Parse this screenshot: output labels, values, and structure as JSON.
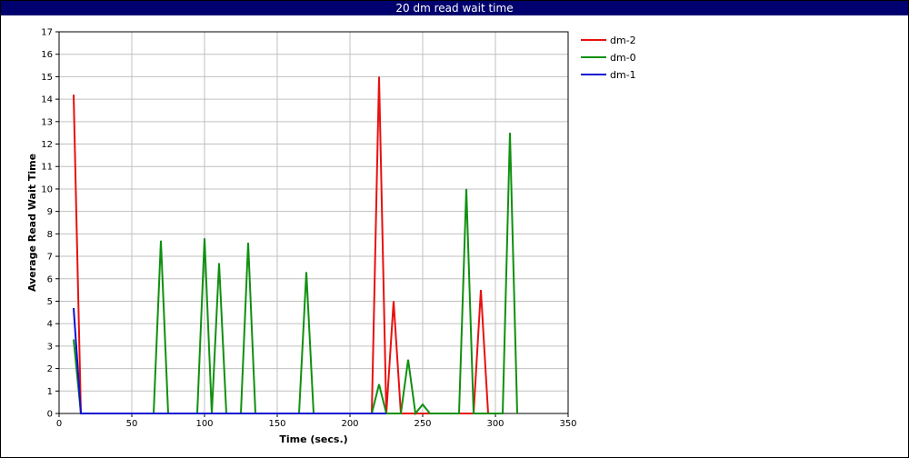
{
  "window": {
    "title": "20 dm read wait time"
  },
  "chart_data": {
    "type": "line",
    "title": "20 dm read wait time",
    "xlabel": "Time (secs.)",
    "ylabel": "Average Read Wait Time",
    "xlim": [
      0,
      350
    ],
    "ylim": [
      0,
      17
    ],
    "xticks": [
      0,
      50,
      100,
      150,
      200,
      250,
      300,
      350
    ],
    "yticks": [
      0,
      1,
      2,
      3,
      4,
      5,
      6,
      7,
      8,
      9,
      10,
      11,
      12,
      13,
      14,
      15,
      16,
      17
    ],
    "grid": true,
    "legend_position": "right",
    "series": [
      {
        "name": "dm-2",
        "color": "#e81010",
        "x": [
          10,
          15,
          20,
          25,
          30,
          35,
          40,
          45,
          50,
          55,
          60,
          65,
          70,
          75,
          80,
          85,
          90,
          95,
          100,
          105,
          110,
          115,
          120,
          125,
          130,
          135,
          140,
          145,
          150,
          155,
          160,
          165,
          170,
          175,
          180,
          185,
          190,
          195,
          200,
          205,
          210,
          215,
          220,
          225,
          230,
          235,
          240,
          245,
          250,
          255,
          260,
          265,
          270,
          275,
          280,
          285,
          290,
          295,
          300
        ],
        "y": [
          14.2,
          0,
          0,
          0,
          0,
          0,
          0,
          0,
          0,
          0,
          0,
          0,
          0,
          0,
          0,
          0,
          0,
          0,
          0,
          0,
          0,
          0,
          0,
          0,
          0,
          0,
          0,
          0,
          0,
          0,
          0,
          0,
          0,
          0,
          0,
          0,
          0,
          0,
          0,
          0,
          0,
          0,
          15,
          0,
          5,
          0,
          0,
          0,
          0,
          0,
          0,
          0,
          0,
          0,
          0,
          0,
          5.5,
          0,
          0
        ]
      },
      {
        "name": "dm-0",
        "color": "#109010",
        "x": [
          10,
          15,
          20,
          25,
          30,
          35,
          40,
          45,
          50,
          55,
          60,
          65,
          70,
          75,
          80,
          85,
          90,
          95,
          100,
          105,
          110,
          115,
          120,
          125,
          130,
          135,
          140,
          145,
          150,
          155,
          160,
          165,
          170,
          175,
          180,
          185,
          190,
          195,
          200,
          205,
          210,
          215,
          220,
          225,
          230,
          235,
          240,
          245,
          250,
          255,
          260,
          265,
          270,
          275,
          280,
          285,
          290,
          295,
          300,
          305,
          310,
          315
        ],
        "y": [
          3.3,
          0,
          0,
          0,
          0,
          0,
          0,
          0,
          0,
          0,
          0,
          0,
          7.7,
          0,
          0,
          0,
          0,
          0,
          7.8,
          0,
          6.7,
          0,
          0,
          0,
          7.6,
          0,
          0,
          0,
          0,
          0,
          0,
          0,
          6.3,
          0,
          0,
          0,
          0,
          0,
          0,
          0,
          0,
          0,
          1.3,
          0,
          0,
          0,
          2.4,
          0,
          0.4,
          0,
          0,
          0,
          0,
          0,
          10,
          0,
          0,
          0,
          0,
          0,
          12.5,
          0
        ]
      },
      {
        "name": "dm-1",
        "color": "#1010d0",
        "x": [
          10,
          15,
          20,
          25,
          30,
          35,
          40,
          45,
          50,
          55,
          60,
          65,
          70,
          75,
          80,
          85,
          90,
          95,
          100,
          105,
          110,
          115,
          120,
          125,
          130,
          135,
          140,
          145,
          150,
          155,
          160,
          165,
          170,
          175,
          180,
          185,
          190,
          195,
          200,
          205,
          210,
          215,
          220,
          225
        ],
        "y": [
          4.7,
          0,
          0,
          0,
          0,
          0,
          0,
          0,
          0,
          0,
          0,
          0,
          0,
          0,
          0,
          0,
          0,
          0,
          0,
          0,
          0,
          0,
          0,
          0,
          0,
          0,
          0,
          0,
          0,
          0,
          0,
          0,
          0,
          0,
          0,
          0,
          0,
          0,
          0,
          0,
          0,
          0,
          0,
          0
        ]
      }
    ]
  }
}
